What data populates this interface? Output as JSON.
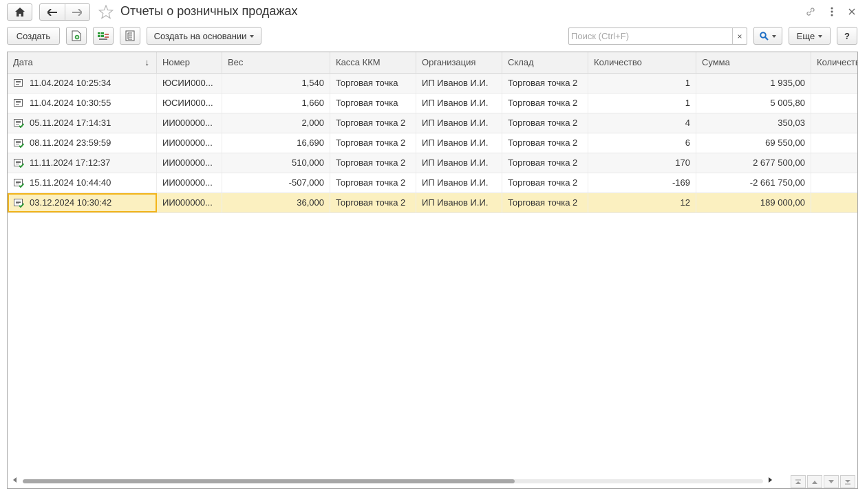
{
  "window": {
    "title": "Отчеты о розничных продажах"
  },
  "toolbar": {
    "create_label": "Создать",
    "create_based_on_label": "Создать на основании",
    "search_placeholder": "Поиск (Ctrl+F)",
    "clear_label": "×",
    "more_label": "Еще",
    "help_label": "?"
  },
  "table": {
    "columns": [
      "Дата",
      "Номер",
      "Вес",
      "Касса ККМ",
      "Организация",
      "Склад",
      "Количество",
      "Сумма",
      "Количеств"
    ],
    "rows": [
      {
        "date": "11.04.2024 10:25:34",
        "number": "ЮСИИ000...",
        "weight": "1,540",
        "kkm": "Торговая точка",
        "org": "ИП Иванов И.И.",
        "warehouse": "Торговая точка 2",
        "qty": "1",
        "sum": "1 935,00",
        "icon": "document-icon"
      },
      {
        "date": "11.04.2024 10:30:55",
        "number": "ЮСИИ000...",
        "weight": "1,660",
        "kkm": "Торговая точка",
        "org": "ИП Иванов И.И.",
        "warehouse": "Торговая точка 2",
        "qty": "1",
        "sum": "5 005,80",
        "icon": "document-icon"
      },
      {
        "date": "05.11.2024 17:14:31",
        "number": "ИИ000000...",
        "weight": "2,000",
        "kkm": "Торговая точка 2",
        "org": "ИП Иванов И.И.",
        "warehouse": "Торговая точка 2",
        "qty": "4",
        "sum": "350,03",
        "icon": "posted-document-icon"
      },
      {
        "date": "08.11.2024 23:59:59",
        "number": "ИИ000000...",
        "weight": "16,690",
        "kkm": "Торговая точка 2",
        "org": "ИП Иванов И.И.",
        "warehouse": "Торговая точка 2",
        "qty": "6",
        "sum": "69 550,00",
        "icon": "posted-document-icon"
      },
      {
        "date": "11.11.2024 17:12:37",
        "number": "ИИ000000...",
        "weight": "510,000",
        "kkm": "Торговая точка 2",
        "org": "ИП Иванов И.И.",
        "warehouse": "Торговая точка 2",
        "qty": "170",
        "sum": "2 677 500,00",
        "icon": "posted-document-icon"
      },
      {
        "date": "15.11.2024 10:44:40",
        "number": "ИИ000000...",
        "weight": "-507,000",
        "kkm": "Торговая точка 2",
        "org": "ИП Иванов И.И.",
        "warehouse": "Торговая точка 2",
        "qty": "-169",
        "sum": "-2 661 750,00",
        "icon": "posted-document-icon"
      },
      {
        "date": "03.12.2024 10:30:42",
        "number": "ИИ000000...",
        "weight": "36,000",
        "kkm": "Торговая точка 2",
        "org": "ИП Иванов И.И.",
        "warehouse": "Торговая точка 2",
        "qty": "12",
        "sum": "189 000,00",
        "icon": "posted-document-icon"
      }
    ],
    "selected_row_index": 6,
    "sort_column": "Дата",
    "sort_direction": "descending"
  },
  "colors": {
    "selection_bg": "#fbf0c0",
    "focus_border": "#f2b51a",
    "header_bg": "#f2f2f2",
    "posted_icon_green": "#2f9c3a"
  }
}
